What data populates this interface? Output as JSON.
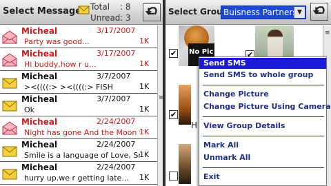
{
  "inbox": {
    "title": "Select Message",
    "total_label": "Total",
    "total_value": ": 8",
    "unread_label": "Unread",
    "unread_value": ": 3",
    "back_icon": "back-arrow-icon",
    "messages": [
      {
        "sender": "Micheal",
        "date": "3/17/2007",
        "preview": "Party was good...",
        "size": "1K",
        "status": "unread",
        "icon": "open-envelope-icon"
      },
      {
        "sender": "Micheal",
        "date": "3/17/2007",
        "preview": "Hi buddy,how r u...",
        "size": "1K",
        "status": "unread",
        "icon": "open-envelope-icon"
      },
      {
        "sender": "Micheal",
        "date": "3/7/2007",
        "preview": "><((((:>  ><((((:> FISH",
        "size": "1K",
        "status": "read",
        "icon": "closed-envelope-icon"
      },
      {
        "sender": "Micheal",
        "date": "3/7/2007",
        "preview": "Ok",
        "size": "1K",
        "status": "read",
        "icon": "closed-envelope-icon"
      },
      {
        "sender": "Micheal",
        "date": "2/24/2007",
        "preview": "Night has gone And the Moon too.",
        "size": "1K",
        "status": "unread",
        "icon": "open-envelope-icon"
      },
      {
        "sender": "Micheal",
        "date": "2/24/2007",
        "preview": "Smile is a language of Love, Smi",
        "size": "1K",
        "status": "read",
        "icon": "closed-envelope-icon"
      },
      {
        "sender": "Micheal",
        "date": "2/24/2007",
        "preview": "hurry up.we r getting late...",
        "size": "1K",
        "status": "read",
        "icon": "closed-envelope-icon"
      }
    ]
  },
  "group": {
    "title": "Select Group",
    "selected_group": "Buisness Partners",
    "nopic_text": "No Pic",
    "h_fragment": "H",
    "checkbox_mark": "✔"
  },
  "menu": {
    "items": [
      {
        "label": "Send SMS",
        "selected": true
      },
      {
        "label": "Send SMS to whole group",
        "selected": false
      },
      {
        "label": "Change Picture",
        "selected": false
      },
      {
        "label": "Change Picture Using Camera",
        "selected": false
      },
      {
        "label": "View Group Details",
        "selected": false
      },
      {
        "label": "Mark All",
        "selected": false
      },
      {
        "label": "Unmark All",
        "selected": false
      },
      {
        "label": "Exit",
        "selected": false
      }
    ]
  },
  "colors": {
    "unread_text": "#d01818",
    "menu_text": "#1d2f86",
    "menu_highlight": "#1a1ad8",
    "dropdown_bg": "#1c48d6"
  }
}
